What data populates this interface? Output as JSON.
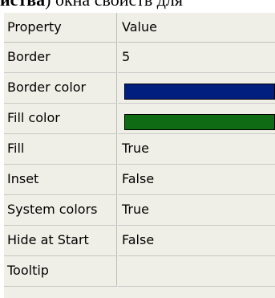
{
  "caption": {
    "bold": "иства",
    "rest": ") окна свойств для"
  },
  "grid": {
    "header": {
      "property": "Property",
      "value": "Value"
    },
    "rows": [
      {
        "name": "Border",
        "value": "5"
      },
      {
        "name": "Border color",
        "value": "",
        "color": "#001f7f"
      },
      {
        "name": "Fill color",
        "value": "",
        "color": "#0f6b14"
      },
      {
        "name": "Fill",
        "value": "True"
      },
      {
        "name": "Inset",
        "value": "False"
      },
      {
        "name": "System colors",
        "value": "True"
      },
      {
        "name": "Hide at Start",
        "value": "False"
      },
      {
        "name": "Tooltip",
        "value": ""
      }
    ]
  }
}
